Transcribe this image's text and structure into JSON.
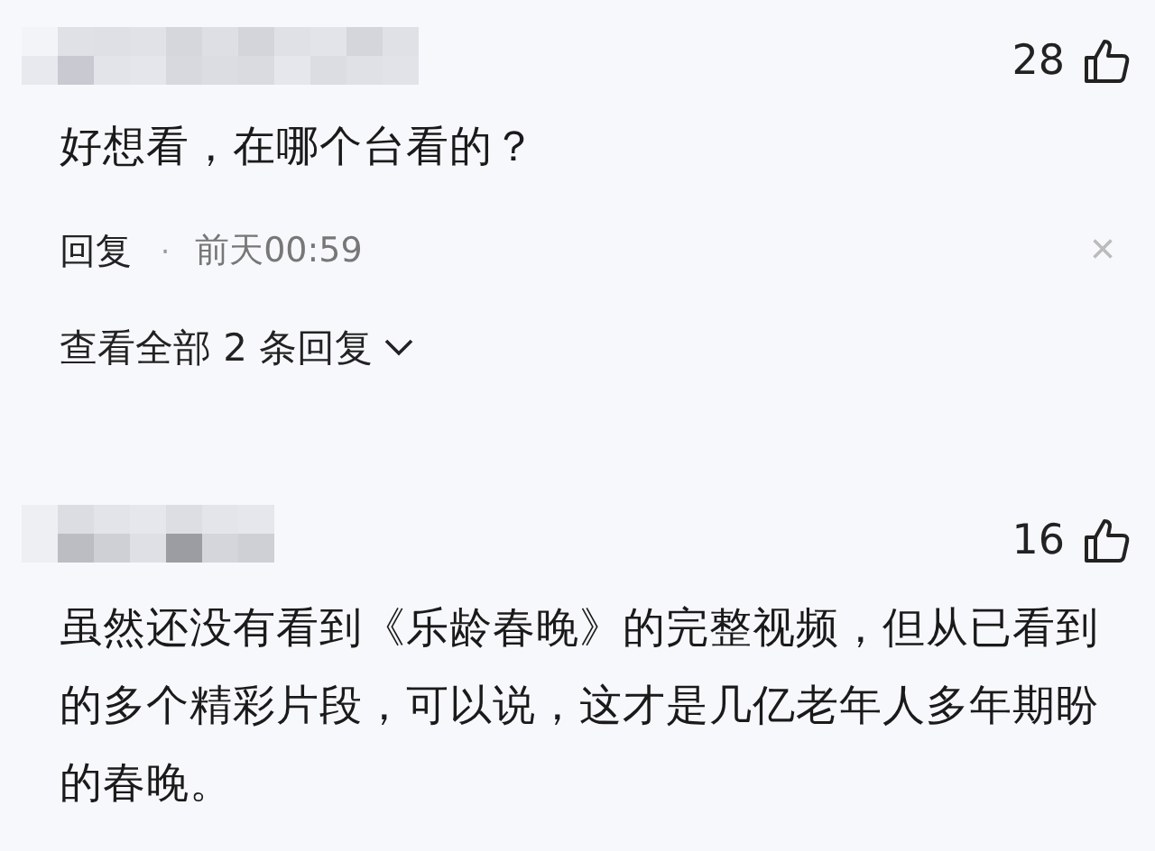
{
  "comments": [
    {
      "likes": "28",
      "text": "好想看，在哪个台看的？",
      "reply_label": "回复",
      "separator": "·",
      "time": "前天00:59",
      "close": "×",
      "view_replies": "查看全部 2 条回复"
    },
    {
      "likes": "16",
      "text": "虽然还没有看到《乐龄春晚》的完整视频，但从已看到的多个精彩片段，可以说，这才是几亿老年人多年期盼的春晚。"
    }
  ]
}
